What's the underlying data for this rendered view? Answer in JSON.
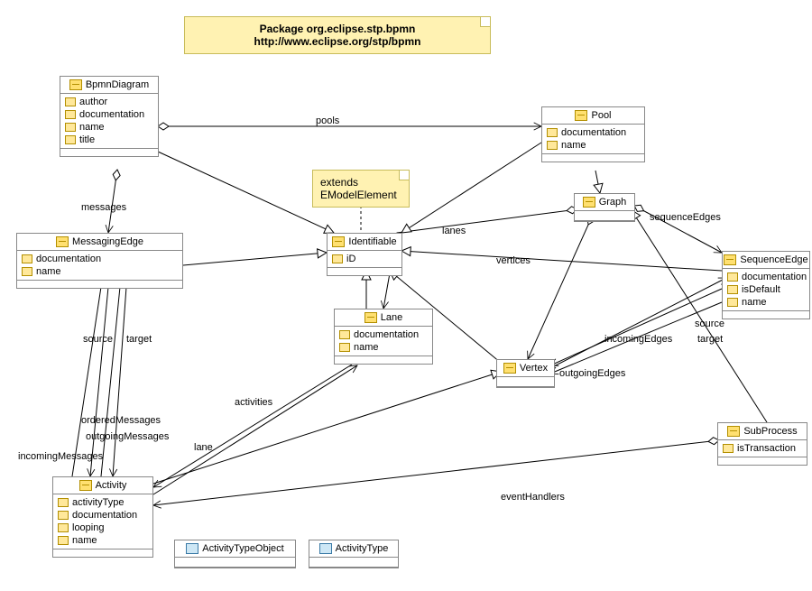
{
  "package": {
    "line1": "Package org.eclipse.stp.bpmn",
    "line2": "http://www.eclipse.org/stp/bpmn"
  },
  "note_extends": {
    "line1": "extends",
    "line2": "EModelElement"
  },
  "classes": {
    "BpmnDiagram": {
      "name": "BpmnDiagram",
      "attrs": [
        "author",
        "documentation",
        "name",
        "title"
      ]
    },
    "Pool": {
      "name": "Pool",
      "attrs": [
        "documentation",
        "name"
      ]
    },
    "MessagingEdge": {
      "name": "MessagingEdge",
      "attrs": [
        "documentation",
        "name"
      ]
    },
    "Identifiable": {
      "name": "Identifiable",
      "attrs": [
        "iD"
      ]
    },
    "Graph": {
      "name": "Graph",
      "attrs": []
    },
    "SequenceEdge": {
      "name": "SequenceEdge",
      "attrs": [
        "documentation",
        "isDefault",
        "name"
      ]
    },
    "Lane": {
      "name": "Lane",
      "attrs": [
        "documentation",
        "name"
      ]
    },
    "Vertex": {
      "name": "Vertex",
      "attrs": []
    },
    "SubProcess": {
      "name": "SubProcess",
      "attrs": [
        "isTransaction"
      ]
    },
    "Activity": {
      "name": "Activity",
      "attrs": [
        "activityType",
        "documentation",
        "looping",
        "name"
      ]
    },
    "ActivityTypeObject": {
      "name": "ActivityTypeObject",
      "attrs": []
    },
    "ActivityType": {
      "name": "ActivityType",
      "attrs": []
    }
  },
  "labels": {
    "pools": "pools",
    "messages": "messages",
    "lanes": "lanes",
    "vertices": "vertices",
    "sequenceEdges": "sequenceEdges",
    "incomingEdges": "incomingEdges",
    "outgoingEdges": "outgoingEdges",
    "sourceMsg": "source",
    "targetMsg": "target",
    "sourceSeq": "source",
    "targetSeq": "target",
    "orderedMessages": "orderedMessages",
    "outgoingMessages": "outgoingMessages",
    "incomingMessages": "incomingMessages",
    "activities": "activities",
    "lane": "lane",
    "eventHandlers": "eventHandlers"
  }
}
